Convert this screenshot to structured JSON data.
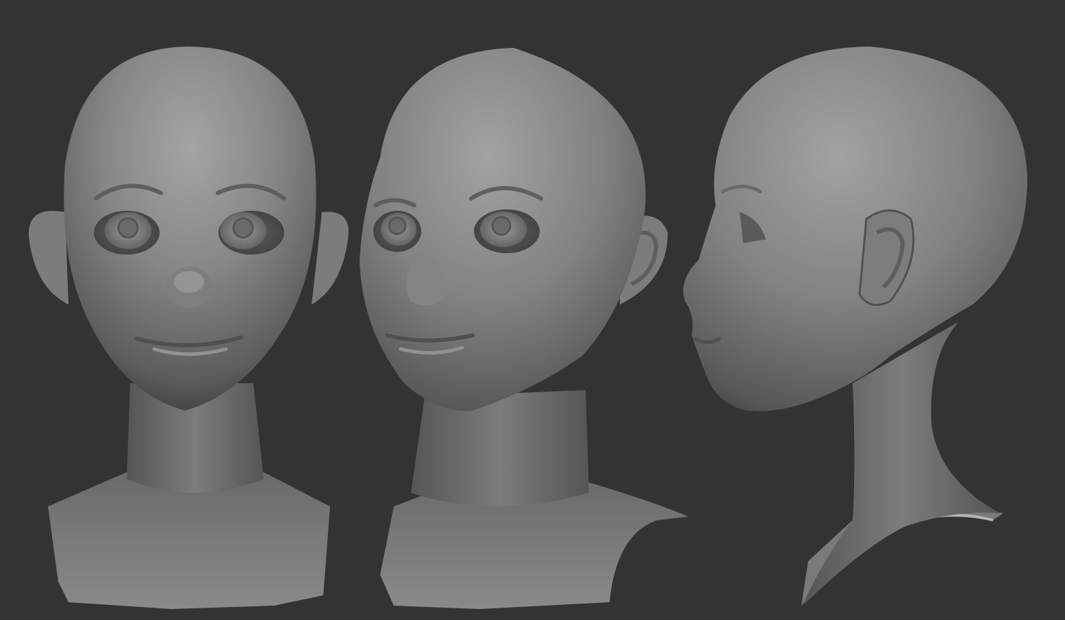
{
  "scene": {
    "background_color": "#333333",
    "clay_color": "#7a7a7a",
    "views": [
      {
        "view": "front"
      },
      {
        "view": "three-quarter"
      },
      {
        "view": "side-profile"
      }
    ]
  }
}
